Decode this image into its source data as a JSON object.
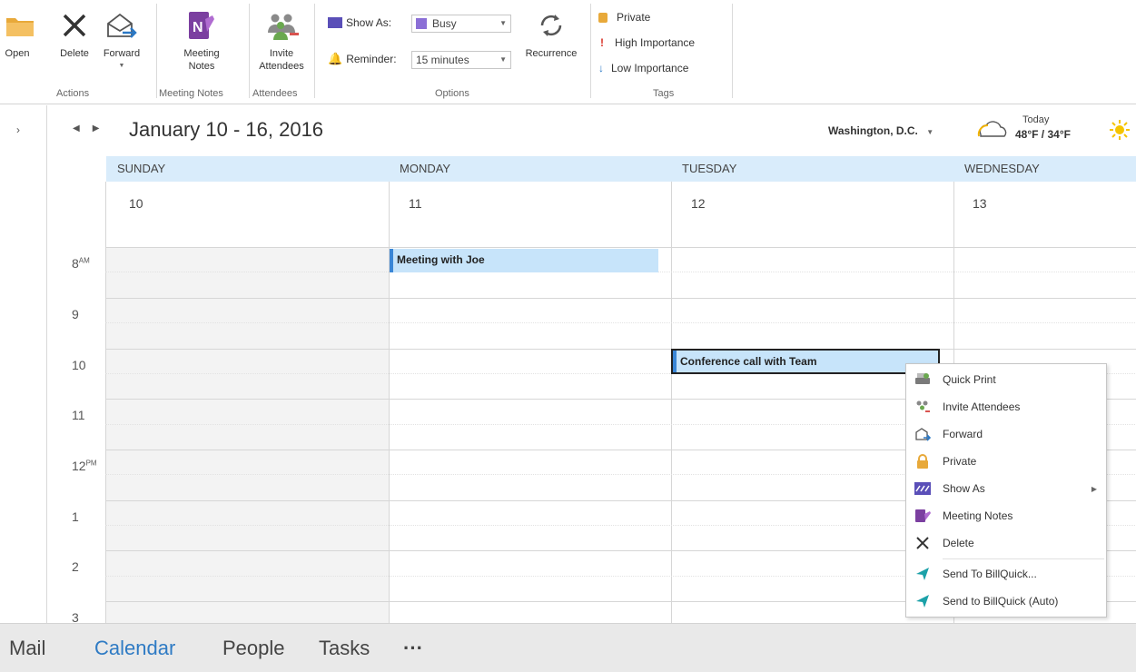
{
  "ribbon": {
    "actions": {
      "open_label": "Open",
      "delete_label": "Delete",
      "forward_label": "Forward",
      "group_label": "Actions"
    },
    "meeting_notes": {
      "label_line1": "Meeting",
      "label_line2": "Notes",
      "group_label": "Meeting Notes"
    },
    "attendees": {
      "label_line1": "Invite",
      "label_line2": "Attendees",
      "group_label": "Attendees"
    },
    "options": {
      "show_as_label": "Show As:",
      "show_as_value": "Busy",
      "reminder_label": "Reminder:",
      "reminder_value": "15 minutes",
      "recurrence_label": "Recurrence",
      "group_label": "Options"
    },
    "tags": {
      "private_label": "Private",
      "high_label": "High Importance",
      "low_label": "Low Importance",
      "group_label": "Tags"
    }
  },
  "calendar": {
    "date_range": "January 10 - 16, 2016",
    "location": "Washington, D.C.",
    "weather_today": "Today",
    "weather_temps": "48°F / 34°F",
    "days": [
      {
        "name": "SUNDAY",
        "num": "10"
      },
      {
        "name": "MONDAY",
        "num": "11"
      },
      {
        "name": "TUESDAY",
        "num": "12"
      },
      {
        "name": "WEDNESDAY",
        "num": "13"
      }
    ],
    "times": [
      {
        "hour": "8",
        "suffix": "AM"
      },
      {
        "hour": "9",
        "suffix": ""
      },
      {
        "hour": "10",
        "suffix": ""
      },
      {
        "hour": "11",
        "suffix": ""
      },
      {
        "hour": "12",
        "suffix": "PM"
      },
      {
        "hour": "1",
        "suffix": ""
      },
      {
        "hour": "2",
        "suffix": ""
      },
      {
        "hour": "3",
        "suffix": ""
      }
    ],
    "appointments": [
      {
        "title": "Meeting with Joe"
      },
      {
        "title": "Conference call with Team"
      }
    ]
  },
  "context_menu": {
    "items": [
      {
        "label": "Quick Print",
        "icon": "printer-icon"
      },
      {
        "label": "Invite Attendees",
        "icon": "people-icon"
      },
      {
        "label": "Forward",
        "icon": "forward-icon"
      },
      {
        "label": "Private",
        "icon": "lock-icon"
      },
      {
        "label": "Show As",
        "icon": "show-as-icon"
      },
      {
        "label": "Meeting Notes",
        "icon": "onenote-icon"
      },
      {
        "label": "Delete",
        "icon": "close-icon"
      },
      {
        "label": "Send To BillQuick...",
        "icon": "send-icon"
      },
      {
        "label": "Send to BillQuick (Auto)",
        "icon": "send-icon"
      }
    ]
  },
  "bottom_nav": {
    "mail": "Mail",
    "calendar": "Calendar",
    "people": "People",
    "tasks": "Tasks",
    "more": "···"
  },
  "colors": {
    "accent": "#2f7bc4",
    "day_header_bg": "#d9ecfb",
    "appointment_bg": "#c7e4fa",
    "show_as_busy": "#8b6fd6"
  }
}
